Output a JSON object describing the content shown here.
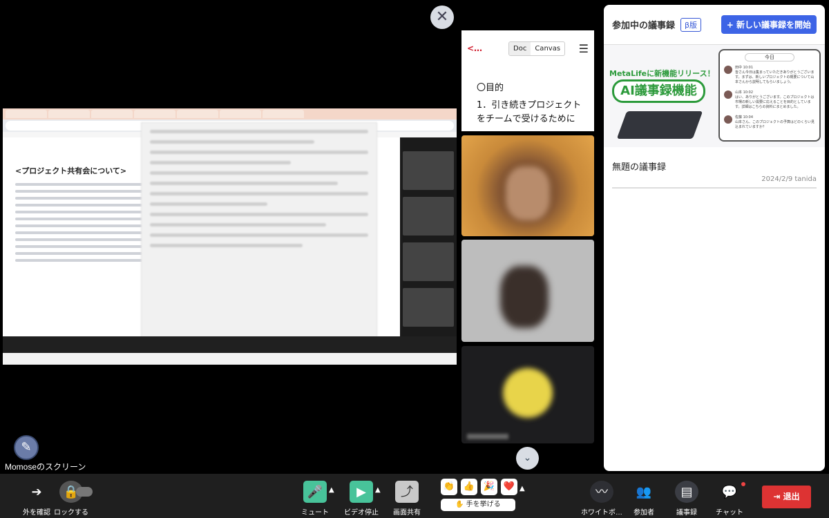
{
  "presenter": {
    "label": "Momoseのスクリーン"
  },
  "shared_screen": {
    "doc_title": "<プロジェクト共有会について>"
  },
  "doc_panel": {
    "logo": "<…",
    "tabs": [
      "Doc",
      "Canvas"
    ],
    "heading": "〇目的",
    "body": "1．引き続きプロジェクトをチームで受けるために"
  },
  "minutes": {
    "title": "参加中の議事録",
    "beta": "β版",
    "new_button": "+ 新しい議事録を開始",
    "banner": {
      "line1": "MetaLifeに新機能リリース！",
      "line2": "AI議事録機能",
      "today": "今日",
      "messages": [
        {
          "name": "田中",
          "time": "10:01",
          "text": "皆さん今日は集まっていただきありがとうございます。まずは、新しいプロジェクトの概要について山本さんから説明してもらいましょう。"
        },
        {
          "name": "山本",
          "time": "10:02",
          "text": "はい、ありがとうございます。このプロジェクトは市場の新しい需要に応えることを目的としています。詳細はこちらの資料にまとめました。"
        },
        {
          "name": "佐藤",
          "time": "10:04",
          "text": "山本さん、このプロジェクトの予算はどのくらい見込まれていますか？"
        }
      ]
    },
    "record": {
      "name": "無題の議事録",
      "meta": "2024/2/9 tanida"
    }
  },
  "toolbar": {
    "view_outside": "外を確認",
    "lock": "ロックする",
    "mute": "ミュート",
    "video_stop": "ビデオ停止",
    "screen_share": "画面共有",
    "reactions": [
      "👏",
      "👍",
      "🎉",
      "❤️"
    ],
    "raise_hand": "✋ 手を挙げる",
    "whiteboard": "ホワイトボ…",
    "participants": "参加者",
    "minutes": "議事録",
    "chat": "チャット",
    "exit": "退出"
  }
}
